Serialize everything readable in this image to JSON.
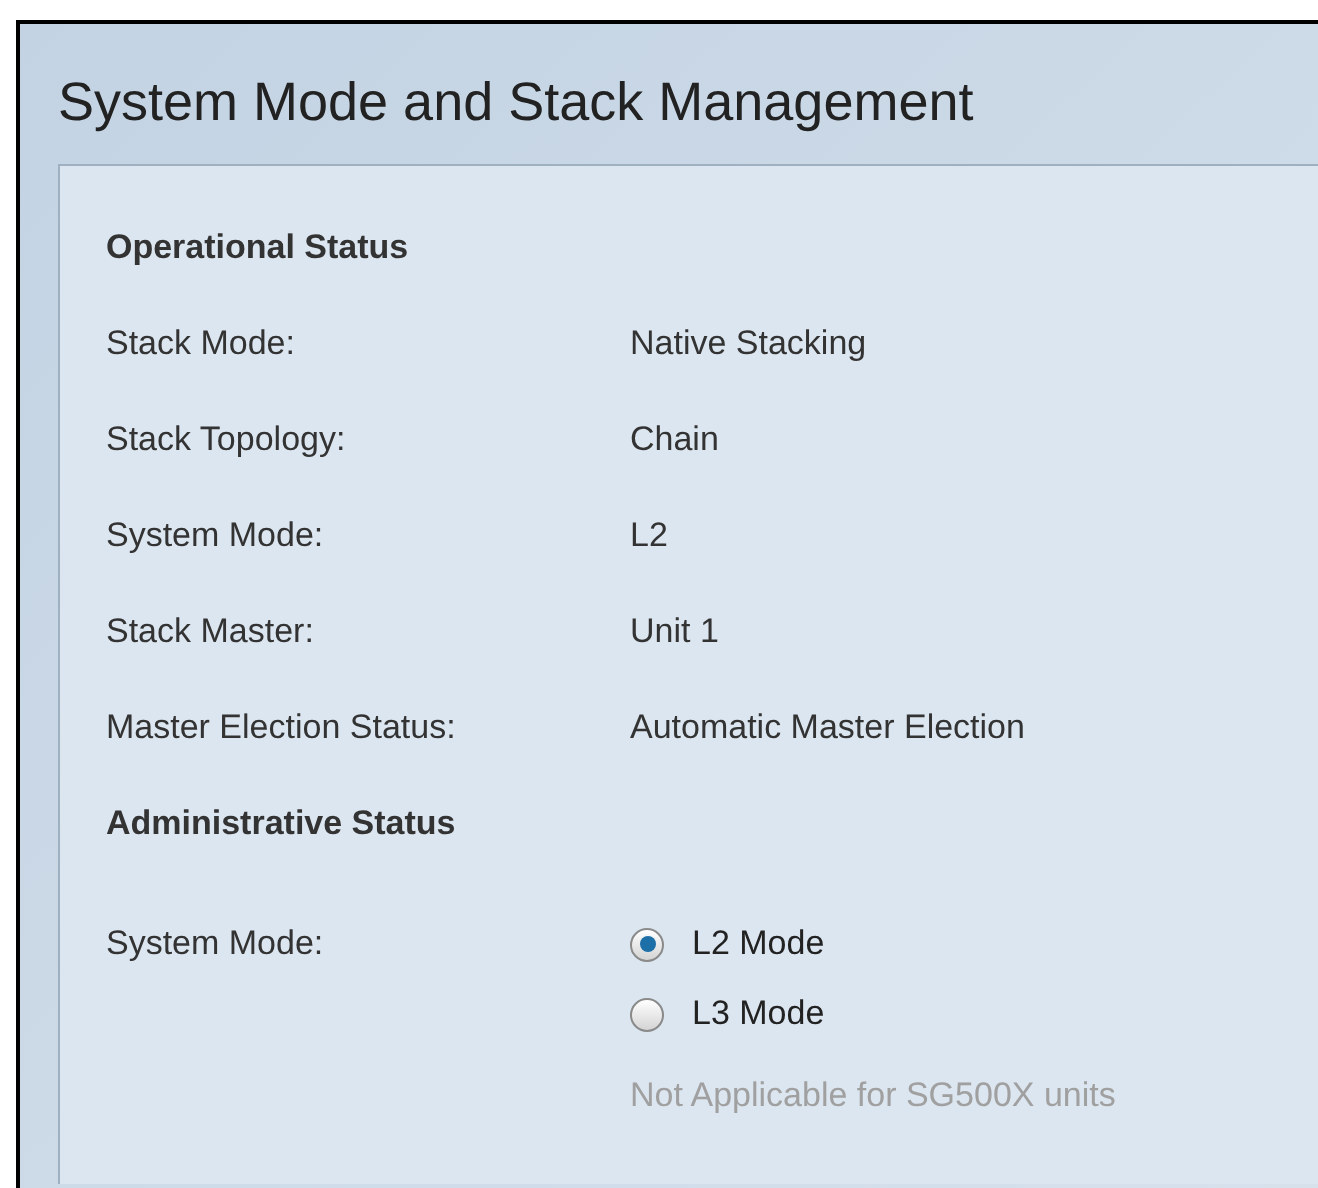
{
  "title": "System Mode and Stack Management",
  "operational": {
    "heading": "Operational Status",
    "rows": [
      {
        "label": "Stack Mode:",
        "value": "Native Stacking"
      },
      {
        "label": "Stack Topology:",
        "value": "Chain"
      },
      {
        "label": "System Mode:",
        "value": "L2"
      },
      {
        "label": "Stack Master:",
        "value": "Unit 1"
      },
      {
        "label": "Master Election Status:",
        "value": "Automatic Master Election"
      }
    ]
  },
  "administrative": {
    "heading": "Administrative Status",
    "label": "System Mode:",
    "options": [
      {
        "label": "L2 Mode",
        "selected": true
      },
      {
        "label": "L3 Mode",
        "selected": false
      }
    ],
    "note": "Not Applicable for SG500X units"
  }
}
